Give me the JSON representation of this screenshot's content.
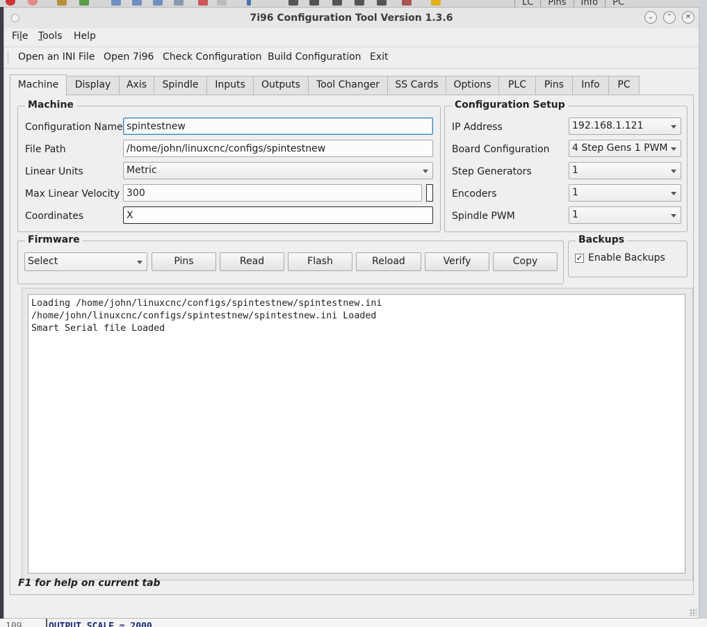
{
  "background": {
    "top_tabs": [
      "LC",
      "Pins",
      "Info",
      "PC"
    ],
    "bottom_line_number": "109",
    "bottom_code": "OUTPUT_SCALE = 2000"
  },
  "window": {
    "title": "7i96 Configuration Tool Version 1.3.6",
    "controls": {
      "minimize": "⌄",
      "maximize": "⌃",
      "close": "✕"
    }
  },
  "menu": [
    {
      "pre": "Fi",
      "u": "l",
      "post": "e"
    },
    {
      "pre": "",
      "u": "T",
      "post": "ools"
    },
    {
      "pre": "Help",
      "u": "",
      "post": ""
    }
  ],
  "toolbar": [
    "Open an INI File",
    "Open 7i96",
    "Check Configuration",
    "Build Configuration",
    "Exit"
  ],
  "tabs": [
    "Machine",
    "Display",
    "Axis",
    "Spindle",
    "Inputs",
    "Outputs",
    "Tool Changer",
    "SS Cards",
    "Options",
    "PLC",
    "Pins",
    "Info",
    "PC"
  ],
  "active_tab": "Machine",
  "machine": {
    "title": "Machine",
    "config_name_label": "Configuration Name",
    "config_name": "spintestnew",
    "file_path_label": "File Path",
    "file_path": "/home/john/linuxcnc/configs/spintestnew",
    "linear_units_label": "Linear Units",
    "linear_units": "Metric",
    "max_velocity_label": "Max Linear Velocity",
    "max_velocity": "300",
    "coordinates_label": "Coordinates",
    "coordinates": "X"
  },
  "config_setup": {
    "title": "Configuration Setup",
    "ip_label": "IP Address",
    "ip": "192.168.1.121",
    "board_label": "Board Configuration",
    "board": "4 Step Gens 1 PWM",
    "stepgens_label": "Step Generators",
    "stepgens": "1",
    "encoders_label": "Encoders",
    "encoders": "1",
    "pwm_label": "Spindle PWM",
    "pwm": "1"
  },
  "firmware": {
    "title": "Firmware",
    "select": "Select",
    "buttons": [
      "Pins",
      "Read",
      "Flash",
      "Reload",
      "Verify",
      "Copy"
    ]
  },
  "backups": {
    "title": "Backups",
    "enable_label": "Enable Backups",
    "checked": "✓"
  },
  "output_lines": [
    "Loading /home/john/linuxcnc/configs/spintestnew/spintestnew.ini",
    "/home/john/linuxcnc/configs/spintestnew/spintestnew.ini Loaded",
    "Smart Serial file Loaded"
  ],
  "status": "F1 for help on current tab",
  "colors": {
    "focus_border": "#3b86c4",
    "window_bg": "#efefef"
  }
}
